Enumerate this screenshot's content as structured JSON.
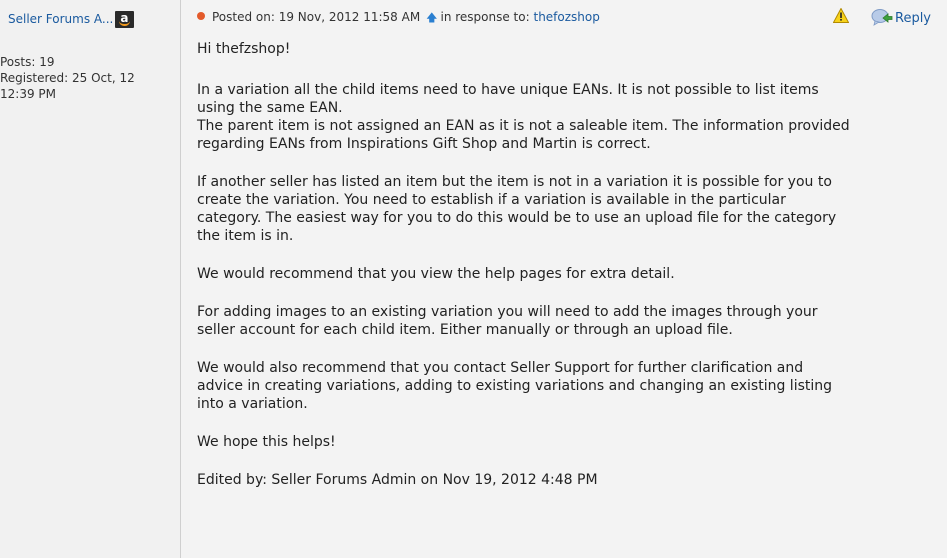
{
  "author": {
    "name": "Seller Forums A...",
    "posts": "Posts: 19",
    "registered_line1": "Registered: 25 Oct, 12",
    "registered_line2": "12:39 PM"
  },
  "meta": {
    "posted": "Posted on: 19 Nov, 2012 11:58 AM",
    "in_response": "in response to:",
    "response_user": "thefozshop",
    "reply_label": "Reply"
  },
  "post": {
    "greeting": "Hi thefzshop!",
    "paragraphs": [
      "In a variation all the child items need to have unique EANs. It is not possible to list items\nusing the same EAN.\nThe parent item is not assigned an EAN as it is not a saleable item. The information provided\nregarding EANs from Inspirations Gift Shop and Martin is correct.",
      "If another seller has listed an item but the item is not in a variation it is possible for you to\ncreate the variation. You need to establish if a variation is available in the particular\ncategory. The easiest way for you to do this would be to use an upload file for the category\nthe item is in.",
      "We would recommend that you view the help pages for extra detail.",
      "For adding images to an existing variation you will need to add the images through your\nseller account for each child item. Either manually or through an upload file.",
      "We would also recommend that you contact Seller Support for further clarification and\nadvice in creating variations, adding to existing variations and changing an existing listing\ninto a variation.",
      "We hope this helps!"
    ],
    "edited": "Edited by: Seller Forums Admin on Nov 19, 2012 4:48 PM"
  },
  "colors": {
    "link": "#1a5a9f",
    "status_dot": "#e35a2a",
    "sidebar_bg": "#f1f1f1",
    "content_bg": "#f3f3f3"
  },
  "icons": {
    "badge": "amazon-badge-icon",
    "status": "status-dot-icon",
    "arrow": "up-arrow-icon",
    "warning": "warning-icon",
    "reply": "reply-icon"
  }
}
